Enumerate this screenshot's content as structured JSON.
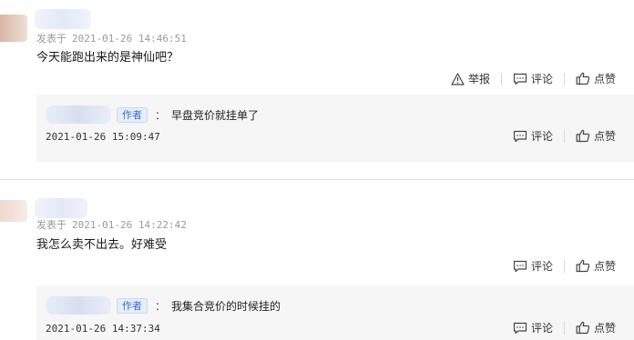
{
  "comments": [
    {
      "published_label": "发表于",
      "timestamp": "2021-01-26 14:46:51",
      "text": "今天能跑出来的是神仙吧？",
      "actions": {
        "report": "举报",
        "comment": "评论",
        "like": "点赞"
      },
      "reply": {
        "author_tag": "作者",
        "colon": "：",
        "text": "早盘竞价就挂单了",
        "timestamp": "2021-01-26 15:09:47",
        "actions": {
          "comment": "评论",
          "like": "点赞"
        }
      }
    },
    {
      "published_label": "发表于",
      "timestamp": "2021-01-26 14:22:42",
      "text": "我怎么卖不出去。好难受",
      "actions": {
        "comment": "评论",
        "like": "点赞"
      },
      "reply": {
        "author_tag": "作者",
        "colon": "：",
        "text": "我集合竞价的时候挂的",
        "timestamp": "2021-01-26 14:37:34",
        "actions": {
          "comment": "评论",
          "like": "点赞"
        }
      }
    }
  ],
  "icons": {
    "report": "warning-icon",
    "comment": "comment-bubble-icon",
    "like": "thumbs-up-icon"
  }
}
